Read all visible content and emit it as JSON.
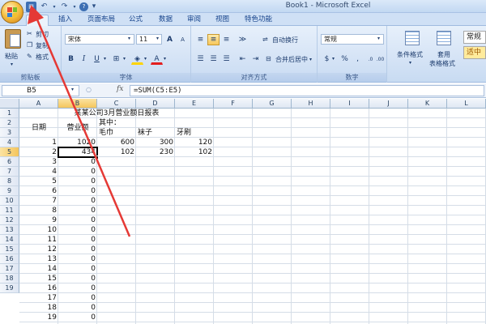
{
  "window": {
    "title": "Book1 - Microsoft Excel"
  },
  "qat": {
    "save": "▣",
    "undo": "↶",
    "redo": "↷",
    "help": "?",
    "customize": "▾"
  },
  "tabs": [
    "插入",
    "页面布局",
    "公式",
    "数据",
    "审阅",
    "视图",
    "特色功能"
  ],
  "ribbon": {
    "clipboard": {
      "label": "剪贴板",
      "paste": "粘贴",
      "cut": "剪切",
      "copy": "复制",
      "format_painter": "格式"
    },
    "font": {
      "label": "字体",
      "name": "宋体",
      "size": "11",
      "bold": "B",
      "italic": "I",
      "underline": "U",
      "grow": "A",
      "shrink": "A",
      "color_label": "A"
    },
    "alignment": {
      "label": "对齐方式",
      "wrap": "自动换行",
      "merge": "合并后居中"
    },
    "number": {
      "label": "数字",
      "format": "常规",
      "currency": "$",
      "percent": "%",
      "comma": ",",
      "inc": ".0",
      "dec": ".00"
    },
    "styles": {
      "conditional": "条件格式",
      "table_line1": "套用",
      "table_line2": "表格格式",
      "normal": "常规",
      "medium": "适中"
    }
  },
  "formula_bar": {
    "name_box": "B5",
    "fx": "fx",
    "formula": "=SUM(C5:E5)"
  },
  "grid": {
    "columns": [
      "A",
      "B",
      "C",
      "D",
      "E",
      "F",
      "G",
      "H",
      "I",
      "J",
      "K",
      "L"
    ],
    "rows": [
      "1",
      "2",
      "3",
      "4",
      "5",
      "6",
      "7",
      "8",
      "9",
      "10",
      "11",
      "12",
      "13",
      "14",
      "15",
      "16",
      "17",
      "18",
      "19"
    ],
    "title": "某某公司3月营业额日报表",
    "header": {
      "date": "日期",
      "revenue": "营业额",
      "of_which": "其中：",
      "towel": "毛巾",
      "socks": "袜子",
      "toothbrush": "牙刷"
    },
    "data": [
      {
        "day": "1",
        "rev": "1020",
        "towel": "600",
        "socks": "300",
        "brush": "120"
      },
      {
        "day": "2",
        "rev": "434",
        "towel": "102",
        "socks": "230",
        "brush": "102"
      },
      {
        "day": "3",
        "rev": "0"
      },
      {
        "day": "4",
        "rev": "0"
      },
      {
        "day": "5",
        "rev": "0"
      },
      {
        "day": "6",
        "rev": "0"
      },
      {
        "day": "7",
        "rev": "0"
      },
      {
        "day": "8",
        "rev": "0"
      },
      {
        "day": "9",
        "rev": "0"
      },
      {
        "day": "10",
        "rev": "0"
      },
      {
        "day": "11",
        "rev": "0"
      },
      {
        "day": "12",
        "rev": "0"
      },
      {
        "day": "13",
        "rev": "0"
      },
      {
        "day": "14",
        "rev": "0"
      },
      {
        "day": "15",
        "rev": "0"
      },
      {
        "day": "16",
        "rev": "0"
      },
      {
        "day": "17",
        "rev": "0"
      },
      {
        "day": "18",
        "rev": "0"
      },
      {
        "day": "19",
        "rev": "0"
      }
    ]
  },
  "colors": {
    "accent": "#15428b",
    "selection": "#f4c55c",
    "annotation_arrow": "#e53935"
  }
}
